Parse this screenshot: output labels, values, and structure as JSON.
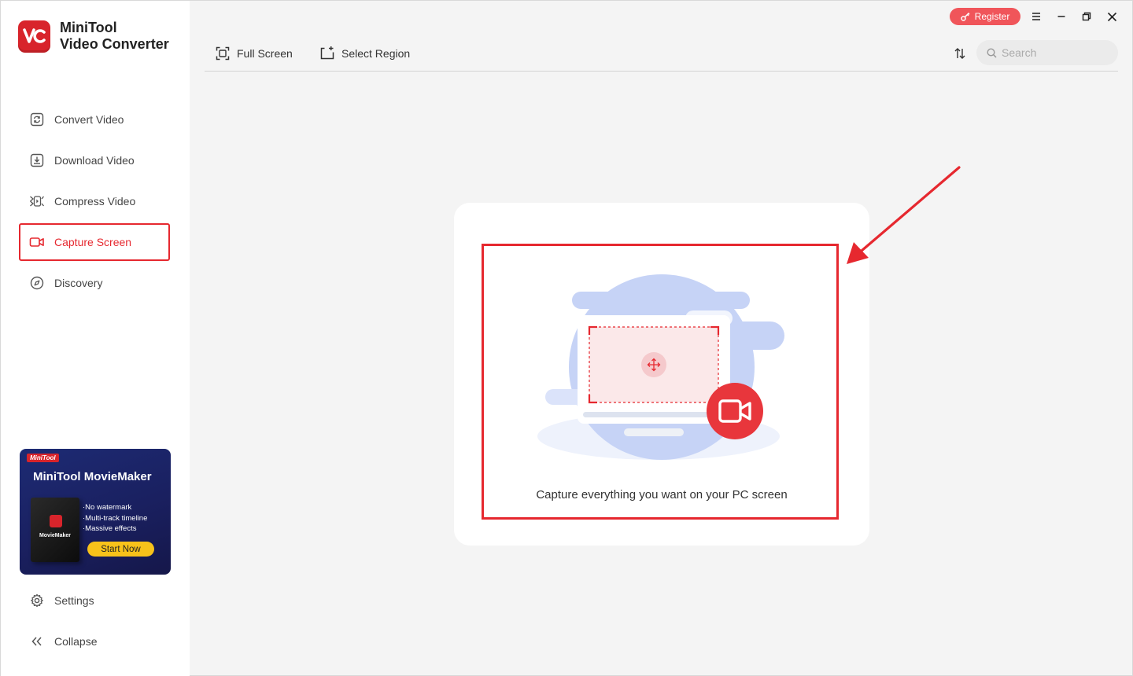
{
  "app": {
    "name_line1": "MiniTool",
    "name_line2": "Video Converter"
  },
  "sidebar": {
    "items": [
      {
        "label": "Convert Video",
        "icon": "convert-icon",
        "active": false
      },
      {
        "label": "Download Video",
        "icon": "download-icon",
        "active": false
      },
      {
        "label": "Compress Video",
        "icon": "compress-icon",
        "active": false
      },
      {
        "label": "Capture Screen",
        "icon": "camera-icon",
        "active": true
      },
      {
        "label": "Discovery",
        "icon": "compass-icon",
        "active": false
      }
    ],
    "settings_label": "Settings",
    "collapse_label": "Collapse"
  },
  "promo": {
    "badge": "MiniTool",
    "title": "MiniTool MovieMaker",
    "box_label": "MovieMaker",
    "features": [
      "No watermark",
      "Multi-track timeline",
      "Massive effects"
    ],
    "cta": "Start Now"
  },
  "titlebar": {
    "register_label": "Register"
  },
  "toolbar": {
    "full_screen_label": "Full Screen",
    "select_region_label": "Select Region",
    "search_placeholder": "Search"
  },
  "main": {
    "caption": "Capture everything you want on your PC screen"
  },
  "colors": {
    "accent": "#e6282f",
    "brand": "#d8242b",
    "register": "#f0555a",
    "illustration_blue": "#c6d3f6"
  }
}
